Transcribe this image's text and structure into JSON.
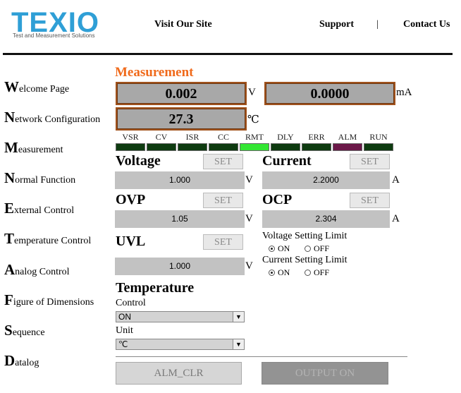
{
  "header": {
    "logo_text": "TEXIO",
    "logo_tagline": "Test and Measurement Solutions",
    "links": [
      "Visit Our Site",
      "Support",
      "|",
      "Contact Us"
    ]
  },
  "sidebar": {
    "items": [
      {
        "cap": "W",
        "rest": "elcome Page"
      },
      {
        "cap": "N",
        "rest": "etwork Configuration"
      },
      {
        "cap": "M",
        "rest": "easurement"
      },
      {
        "cap": "N",
        "rest": "ormal Function"
      },
      {
        "cap": "E",
        "rest": "xternal Control"
      },
      {
        "cap": "T",
        "rest": "emperature Control"
      },
      {
        "cap": "A",
        "rest": "nalog Control"
      },
      {
        "cap": "F",
        "rest": "igure of Dimensions"
      },
      {
        "cap": "S",
        "rest": "equence"
      },
      {
        "cap": "D",
        "rest": "atalog"
      }
    ]
  },
  "measurement": {
    "title": "Measurement",
    "voltage": "0.002",
    "voltage_unit": "V",
    "current": "0.0000",
    "current_unit": "mA",
    "temperature": "27.3",
    "temperature_unit": "℃"
  },
  "indicators": {
    "labels": [
      "VSR",
      "CV",
      "ISR",
      "CC",
      "RMT",
      "DLY",
      "ERR",
      "ALM",
      "RUN"
    ],
    "colors": [
      "#0e3b10",
      "#0e3b10",
      "#0e3b10",
      "#0e3b10",
      "#33e633",
      "#0e3b10",
      "#0e3b10",
      "#6b1848",
      "#0e3b10"
    ]
  },
  "settings": {
    "set_label": "SET",
    "voltage": {
      "title": "Voltage",
      "value": "1.000",
      "unit": "V"
    },
    "current": {
      "title": "Current",
      "value": "2.2000",
      "unit": "A"
    },
    "ovp": {
      "title": "OVP",
      "value": "1.05",
      "unit": "V"
    },
    "ocp": {
      "title": "OCP",
      "value": "2.304",
      "unit": "A"
    },
    "uvl": {
      "title": "UVL",
      "value": "1.000",
      "unit": "V"
    },
    "voltage_limit": {
      "title": "Voltage Setting Limit",
      "on": "ON",
      "off": "OFF",
      "selected": "ON"
    },
    "current_limit": {
      "title": "Current Setting Limit",
      "on": "ON",
      "off": "OFF",
      "selected": "ON"
    }
  },
  "temperature": {
    "title": "Temperature",
    "control_label": "Control",
    "control_value": "ON",
    "unit_label": "Unit",
    "unit_value": "℃"
  },
  "buttons": {
    "alm_clr": "ALM_CLR",
    "output": "OUTPUT ON"
  }
}
